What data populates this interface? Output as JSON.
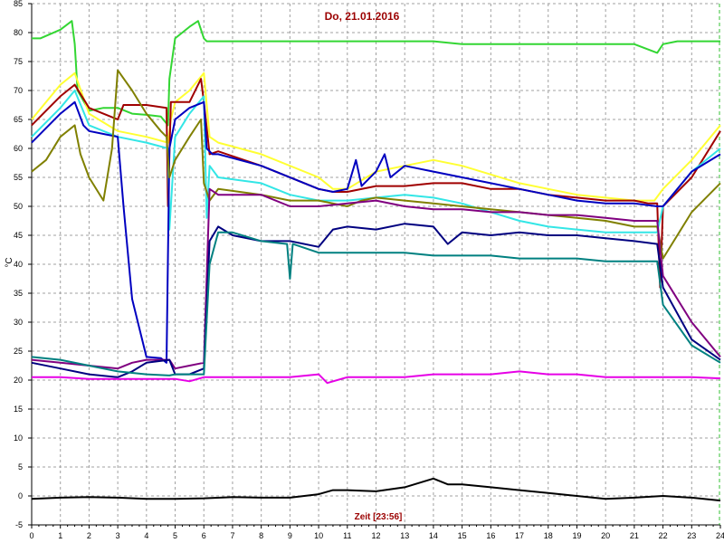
{
  "chart_data": {
    "type": "line",
    "title": "Do, 21.01.2016",
    "xlabel": "Zeit [23:56]",
    "ylabel": "°C",
    "xlim": [
      0,
      24
    ],
    "ylim": [
      -5,
      85
    ],
    "x_ticks": [
      "0",
      "1",
      "2",
      "3",
      "4",
      "5",
      "6",
      "7",
      "8",
      "9",
      "10",
      "11",
      "12",
      "13",
      "14",
      "15",
      "16",
      "17",
      "18",
      "19",
      "20",
      "21",
      "22",
      "23",
      "24"
    ],
    "y_ticks": [
      "-5",
      "0",
      "5",
      "10",
      "15",
      "20",
      "25",
      "30",
      "35",
      "40",
      "45",
      "50",
      "55",
      "60",
      "65",
      "70",
      "75",
      "80",
      "85"
    ],
    "grid": "dashed",
    "marker_line_x": 24,
    "series": [
      {
        "color": "#33d633",
        "x": [
          0,
          0.3,
          1,
          1.4,
          1.5,
          1.6,
          2,
          2.5,
          3,
          3.5,
          4,
          4.5,
          4.75,
          4.8,
          5,
          5.5,
          5.8,
          6,
          6.1,
          6.5,
          8,
          10,
          11,
          12,
          13,
          14,
          15,
          16,
          17,
          18,
          19,
          20,
          21,
          21.8,
          22,
          22.5,
          23,
          24
        ],
        "y": [
          79,
          79,
          80.5,
          82,
          78,
          70,
          66.5,
          67,
          67,
          66,
          65.8,
          65.5,
          64,
          72,
          79,
          81,
          82,
          79,
          78.5,
          78.5,
          78.5,
          78.5,
          78.5,
          78.5,
          78.5,
          78.5,
          78,
          78,
          78,
          78,
          78,
          78,
          78,
          76.5,
          78,
          78.5,
          78.5,
          78.5
        ]
      },
      {
        "color": "#ffff33",
        "x": [
          0,
          1,
          1.5,
          2,
          3,
          4,
          4.75,
          4.85,
          5,
          5.5,
          6,
          6.2,
          6.5,
          8,
          10,
          10.5,
          11,
          12,
          13,
          14,
          15,
          16,
          17,
          18,
          19,
          20,
          21,
          21.7,
          22,
          23,
          24
        ],
        "y": [
          65,
          71,
          73,
          66,
          63,
          62,
          61,
          65,
          68,
          70,
          73,
          62,
          61,
          59,
          55,
          53,
          53,
          56,
          57,
          58,
          57,
          55.5,
          54,
          53,
          52,
          51.5,
          51,
          51,
          53,
          58,
          64
        ]
      },
      {
        "color": "#a00000",
        "x": [
          0,
          1,
          1.5,
          2,
          3,
          3.2,
          4,
          4.7,
          4.75,
          4.85,
          5,
          5.5,
          5.9,
          6,
          6.2,
          6.5,
          8,
          10,
          10.5,
          11,
          12,
          13,
          14,
          15,
          16,
          17,
          18,
          19,
          20,
          21,
          21.5,
          21.8,
          21.9,
          22,
          23,
          24
        ],
        "y": [
          64,
          69,
          71,
          67,
          65,
          67.5,
          67.5,
          67,
          50,
          68,
          68,
          68,
          72,
          68,
          59,
          59.5,
          57,
          53,
          52.5,
          52.5,
          53.5,
          53.5,
          54,
          54,
          53,
          53,
          52,
          51.5,
          51,
          51,
          50.5,
          50.5,
          36,
          50,
          55,
          63
        ]
      },
      {
        "color": "#33e6e6",
        "x": [
          0,
          1,
          1.5,
          2,
          3,
          4,
          4.75,
          4.8,
          5,
          5.5,
          6,
          6.1,
          6.2,
          6.5,
          8,
          9,
          10,
          11,
          12,
          13,
          14,
          15,
          16,
          17,
          18,
          19,
          20,
          21,
          21.8,
          22,
          23,
          24
        ],
        "y": [
          62,
          67,
          70,
          64,
          62,
          61,
          60,
          46,
          62,
          66,
          69,
          48,
          57,
          55,
          54,
          52,
          51,
          51,
          51.5,
          52,
          51.5,
          50.5,
          49,
          47.5,
          46.5,
          46,
          45.5,
          45.5,
          45.5,
          50,
          56,
          60
        ]
      },
      {
        "color": "#0000c0",
        "x": [
          0,
          1,
          1.5,
          1.8,
          2,
          2.5,
          3,
          3.2,
          3.5,
          4,
          4.5,
          4.7,
          4.8,
          5,
          5.5,
          6,
          6.1,
          6.3,
          6.5,
          8,
          10,
          10.5,
          11,
          11.3,
          11.5,
          12,
          12.3,
          12.5,
          13,
          14,
          15,
          16,
          17,
          18,
          19,
          20,
          21,
          21.8,
          22,
          23,
          24
        ],
        "y": [
          61,
          66,
          68,
          64,
          63,
          62.5,
          62,
          50,
          34,
          24,
          23.8,
          23,
          60,
          65,
          67,
          68,
          60,
          59,
          59,
          57,
          53,
          52.5,
          53,
          58,
          53.5,
          56,
          59,
          55,
          57,
          56,
          55,
          54,
          53,
          52,
          51,
          50.5,
          50.5,
          50,
          50,
          56,
          59
        ]
      },
      {
        "color": "#808000",
        "x": [
          0,
          0.5,
          1,
          1.5,
          1.7,
          2,
          2.5,
          2.8,
          3,
          3.5,
          4,
          4.5,
          4.7,
          4.8,
          5,
          5.5,
          5.9,
          6,
          6.2,
          6.5,
          8,
          9,
          10,
          11,
          11.5,
          12,
          13,
          14,
          15,
          16,
          17,
          18,
          19,
          20,
          21,
          21.8,
          22,
          23,
          24
        ],
        "y": [
          56,
          58,
          62,
          64,
          59,
          55,
          51,
          60,
          73.5,
          70,
          66,
          63,
          62,
          55,
          58,
          62,
          65,
          54,
          51,
          53,
          52,
          51,
          51,
          50,
          51,
          51.5,
          51,
          50.5,
          50,
          49.5,
          49,
          48.5,
          48,
          47.5,
          46.5,
          46.5,
          41,
          49,
          54
        ]
      },
      {
        "color": "#800080",
        "x": [
          0,
          1,
          2,
          3,
          3.5,
          4,
          4.8,
          5,
          5.5,
          6,
          6.2,
          6.5,
          8,
          9,
          10,
          11,
          12,
          13,
          14,
          15,
          16,
          17,
          18,
          19,
          20,
          21,
          21.8,
          22,
          23,
          24
        ],
        "y": [
          23.5,
          23,
          22.5,
          22,
          23,
          23.5,
          23.5,
          22,
          22.5,
          23,
          53,
          52,
          52,
          50,
          50,
          50.5,
          51,
          50,
          49.5,
          49.5,
          49,
          49,
          48.5,
          48.5,
          48,
          47.5,
          47.5,
          38,
          30,
          24
        ]
      },
      {
        "color": "#000080",
        "x": [
          0,
          1,
          2,
          3,
          3.5,
          4,
          4.8,
          5,
          5.5,
          6,
          6.2,
          6.5,
          7,
          8,
          9,
          10,
          10.5,
          11,
          12,
          13,
          14,
          14.5,
          15,
          16,
          17,
          18,
          19,
          20,
          21,
          21.8,
          22,
          23,
          24
        ],
        "y": [
          23,
          22,
          21,
          20.5,
          21.5,
          23,
          23.5,
          21,
          21,
          22,
          44,
          46.5,
          45,
          44,
          44,
          43,
          46,
          46.5,
          46,
          47,
          46.5,
          43.5,
          45.5,
          45,
          45.5,
          45,
          45,
          44.5,
          44,
          43.5,
          36,
          27,
          23.5
        ]
      },
      {
        "color": "#008080",
        "x": [
          0,
          1,
          2,
          3,
          4,
          4.8,
          5,
          5.5,
          6,
          6.2,
          6.5,
          7,
          8,
          8.9,
          9,
          9.1,
          10,
          11,
          12,
          13,
          14,
          15,
          16,
          17,
          18,
          19,
          20,
          21,
          21.8,
          22,
          23,
          24
        ],
        "y": [
          24,
          23.5,
          22.5,
          21.5,
          21,
          20.8,
          21,
          21,
          21,
          40,
          45.5,
          45.5,
          44,
          43.5,
          37.5,
          43.5,
          42,
          42,
          42,
          42,
          41.5,
          41.5,
          41.5,
          41,
          41,
          41,
          40.5,
          40.5,
          40.5,
          33,
          26,
          23
        ]
      },
      {
        "color": "#e600e6",
        "x": [
          0,
          1,
          2,
          3,
          4,
          5,
          5.5,
          6,
          7,
          9,
          10,
          10.3,
          11,
          12,
          13,
          14,
          15,
          16,
          17,
          18,
          19,
          20,
          21,
          22,
          23,
          24
        ],
        "y": [
          20.5,
          20.5,
          20.2,
          20.2,
          20.2,
          20.2,
          19.8,
          20.5,
          20.5,
          20.5,
          21,
          19.5,
          20.5,
          20.5,
          20.5,
          21,
          21,
          21,
          21.5,
          21,
          21,
          20.5,
          20.5,
          20.5,
          20.5,
          20.3
        ]
      },
      {
        "color": "#000000",
        "x": [
          0,
          1,
          2,
          3,
          4,
          5,
          6,
          7,
          8,
          9,
          10,
          10.5,
          11,
          12,
          13,
          14,
          14.5,
          15,
          16,
          17,
          18,
          19,
          20,
          21,
          22,
          23,
          24
        ],
        "y": [
          -0.5,
          -0.3,
          -0.2,
          -0.3,
          -0.5,
          -0.5,
          -0.4,
          -0.2,
          -0.3,
          -0.3,
          0.3,
          1,
          1,
          0.8,
          1.5,
          3,
          2,
          2,
          1.5,
          1,
          0.5,
          0,
          -0.5,
          -0.3,
          0,
          -0.3,
          -0.8
        ]
      }
    ]
  }
}
